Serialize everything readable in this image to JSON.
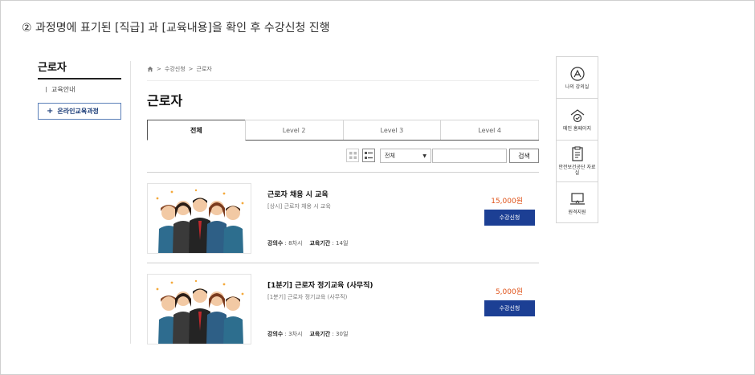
{
  "instruction": "② 과정명에 표기된 [직급] 과 [교육내용]을 확인 후 수강신청 진행",
  "sidebar": {
    "title": "근로자",
    "items": [
      {
        "label": "교육안내"
      }
    ],
    "active_button": {
      "label": "온라인교육과정"
    }
  },
  "breadcrumb": {
    "items": [
      "수강신청",
      "근로자"
    ],
    "separator": ">"
  },
  "page_title": "근로자",
  "tabs": [
    {
      "label": "전체",
      "active": true
    },
    {
      "label": "Level 2",
      "active": false
    },
    {
      "label": "Level 3",
      "active": false
    },
    {
      "label": "Level 4",
      "active": false
    }
  ],
  "filter": {
    "select_value": "전체",
    "search_value": "",
    "search_button": "검색"
  },
  "courses": [
    {
      "title": "근로자 채용 시 교육",
      "subtitle": "[상시] 근로자 채용 시 교육",
      "lessons_label": "강의수",
      "lessons_value": " : 8차시",
      "period_label": "교육기간",
      "period_value": " : 14일",
      "price": "15,000원",
      "apply_label": "수강신청"
    },
    {
      "title": "[1분기] 근로자 정기교육 (사무직)",
      "subtitle": "[1분기] 근로자 정기교육 (사무직)",
      "lessons_label": "강의수",
      "lessons_value": " : 3차시",
      "period_label": "교육기간",
      "period_value": " : 30일",
      "price": "5,000원",
      "apply_label": "수강신청"
    }
  ],
  "quick_menu": [
    {
      "icon": "my-classroom-icon",
      "label": "나의 강의실"
    },
    {
      "icon": "home-shield-icon",
      "label": "메인 홈페이지"
    },
    {
      "icon": "document-icon",
      "label": "안전보건공단 자료실"
    },
    {
      "icon": "remote-support-icon",
      "label": "원격지원"
    }
  ],
  "colors": {
    "accent_blue": "#1c3f94",
    "price_orange": "#e0541b",
    "sidebar_button_border": "#5b7fb8"
  }
}
